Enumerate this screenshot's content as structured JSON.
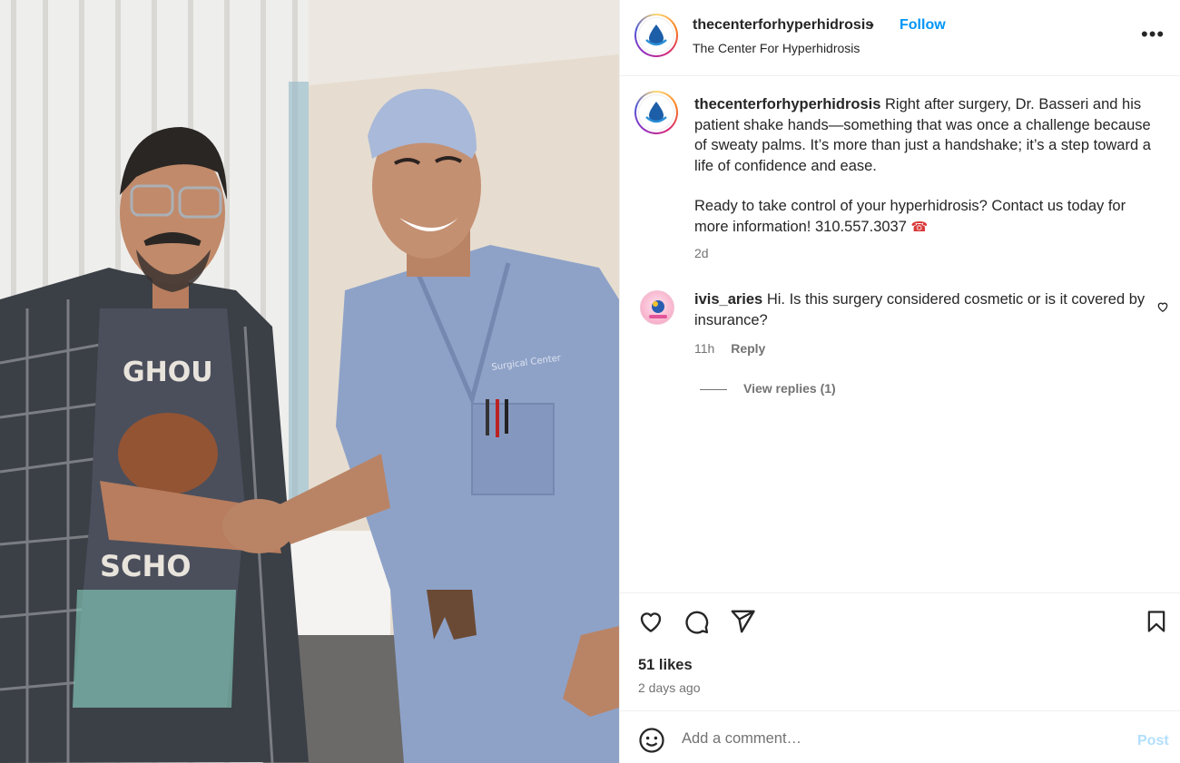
{
  "post": {
    "username": "thecenterforhyperhidrosis",
    "separator": "•",
    "follow_label": "Follow",
    "subtitle": "The Center For Hyperhidrosis",
    "more_label": "•••"
  },
  "caption": {
    "username": "thecenterforhyperhidrosis",
    "text_1": "Right after surgery, Dr. Basseri and his patient shake hands—something that was once a challenge because of sweaty palms. It’s more than just a handshake; it’s a step toward a life of confidence and ease.",
    "text_2": "Ready to take control of your hyperhidrosis? Contact us today for more information! 310.557.3037",
    "phone_emoji": "☎",
    "time": "2d"
  },
  "comments": [
    {
      "username": "ivis_aries",
      "text": "Hi. Is this surgery considered cosmetic or is it covered by insurance?",
      "time": "11h",
      "reply_label": "Reply",
      "view_replies": "View replies (1)"
    }
  ],
  "stats": {
    "likes": "51 likes",
    "posted": "2 days ago"
  },
  "composer": {
    "placeholder": "Add a comment…",
    "post_label": "Post"
  },
  "photo": {
    "scrubs_logo_text": "Surgical Center",
    "shirt_text_top": "GHOU",
    "shirt_text_bottom": "SCHO"
  },
  "colors": {
    "link": "#0095f6",
    "muted": "#737373",
    "post_disabled": "#b2dffc",
    "scrubs": "#8ea2c8"
  },
  "icons": [
    "drop-logo-icon",
    "more-icon",
    "heart-icon",
    "comment-icon",
    "share-icon",
    "bookmark-icon",
    "emoji-icon",
    "telephone-icon"
  ]
}
